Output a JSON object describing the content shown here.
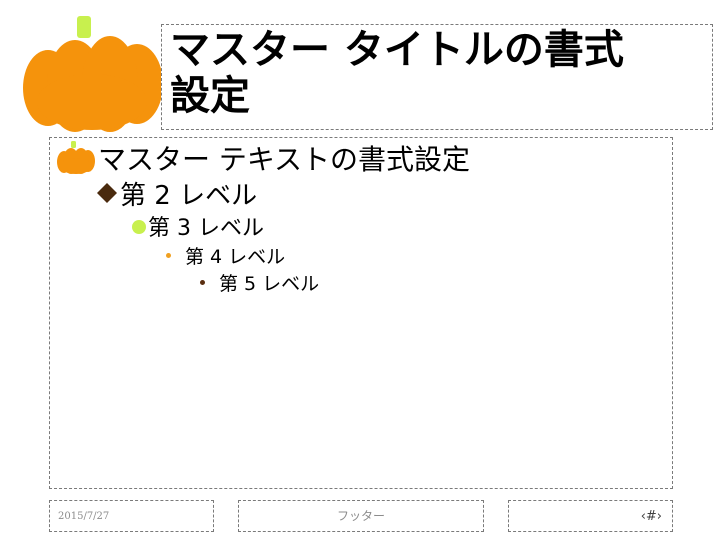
{
  "title": {
    "line1": "マスター タイトルの書式",
    "line2": "設定"
  },
  "body": {
    "level1": "マスター テキストの書式設定",
    "level2": "第 2 レベル",
    "level3": "第 3 レベル",
    "level4": "第 4 レベル",
    "level5": "第 5 レベル"
  },
  "footer": {
    "date": "2015/7/27",
    "text": "フッター",
    "slide_number": "‹#›"
  },
  "icons": {
    "title_decoration": "pumpkin-icon",
    "level1_bullet": "pumpkin-icon",
    "level2_bullet": "diamond-icon",
    "level3_bullet": "circle-icon",
    "level4_bullet": "dot-icon",
    "level5_bullet": "dot-icon"
  },
  "colors": {
    "pumpkin": "#f5930c",
    "stem": "#c8f04e",
    "diamond": "#4a2a0e",
    "level3_bullet": "#c8f04e",
    "level4_bullet": "#f0a020",
    "level5_bullet": "#5a2e10",
    "placeholder_border": "#7a7a7a"
  }
}
